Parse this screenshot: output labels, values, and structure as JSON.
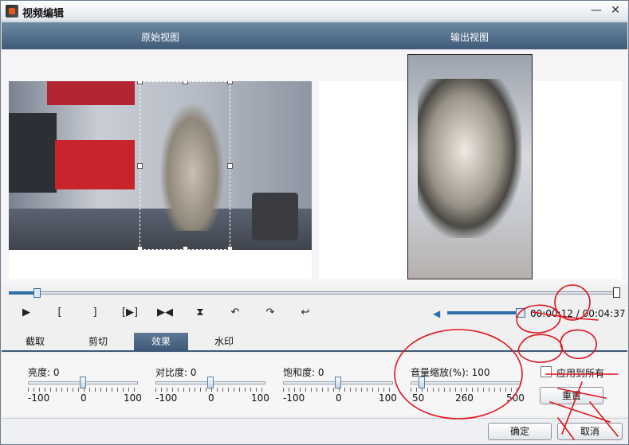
{
  "window": {
    "title": "视频编辑",
    "minimize_glyph": "—",
    "close_glyph": "✕"
  },
  "views": {
    "original_label": "原始视图",
    "output_label": "输出视图"
  },
  "seek": {
    "progress_fraction": 0.046
  },
  "controls": {
    "play_glyph": "▶",
    "mark_in_glyph": "[",
    "mark_out_glyph": "]",
    "step_glyph": "[▶]",
    "skip_glyph": "▶◀",
    "flip_v_glyph": "⧗",
    "rotate_left_glyph": "↶",
    "rotate_right_glyph": "↷",
    "undo_glyph": "↩",
    "volume_fraction": 0.9,
    "time": "00:00:12 / 00:04:37"
  },
  "tabs": [
    {
      "label": "截取",
      "active": false
    },
    {
      "label": "剪切",
      "active": false
    },
    {
      "label": "效果",
      "active": true
    },
    {
      "label": "水印",
      "active": false
    }
  ],
  "effects": {
    "brightness": {
      "label": "亮度: 0",
      "min": "-100",
      "mid": "0",
      "max": "100",
      "fraction": 0.5
    },
    "contrast": {
      "label": "对比度: 0",
      "min": "-100",
      "mid": "0",
      "max": "100",
      "fraction": 0.5
    },
    "saturation": {
      "label": "饱和度: 0",
      "min": "-100",
      "mid": "0",
      "max": "100",
      "fraction": 0.5
    },
    "volume_scale": {
      "label": "音量缩放(%): 100",
      "min": "50",
      "mid": "260",
      "max": "500",
      "fraction": 0.1
    },
    "apply_all_label": "应用到所有",
    "reset_label": "重置"
  },
  "footer": {
    "ok_label": "确定",
    "cancel_label": "取消"
  },
  "colors": {
    "accent": "#3e5a78",
    "annotation": "#e0141e"
  },
  "icons": {
    "volume": "speaker-icon",
    "app": "video-app-icon"
  }
}
